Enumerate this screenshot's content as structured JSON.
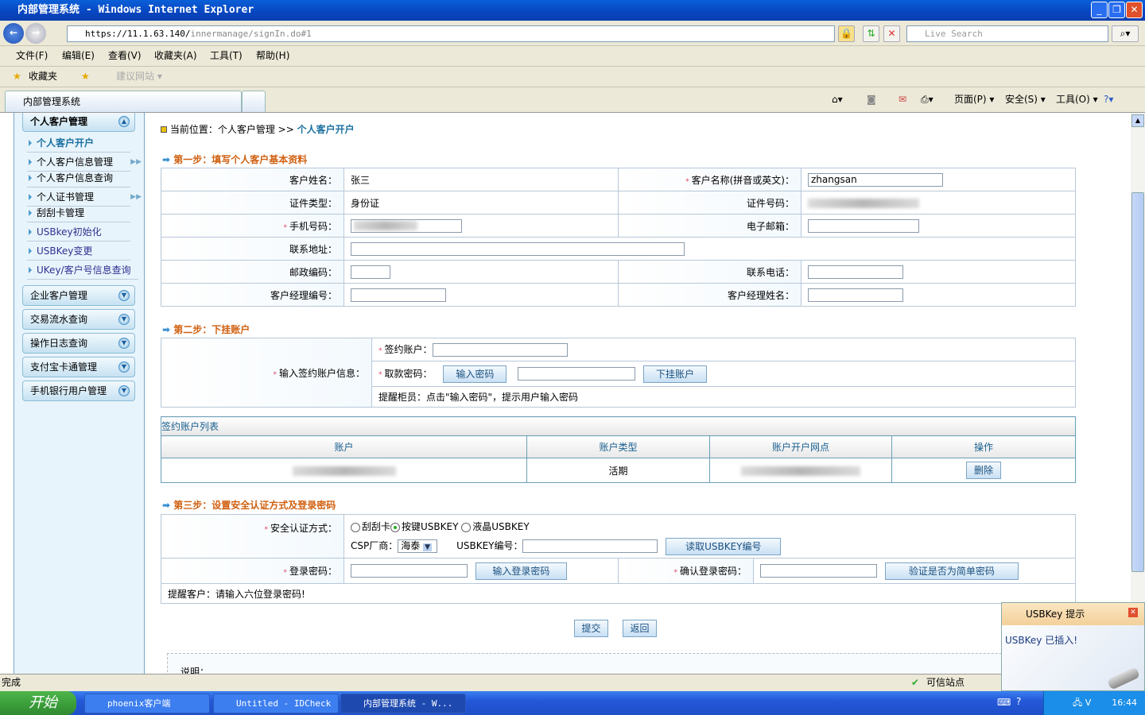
{
  "window": {
    "title": "内部管理系统 - Windows Internet Explorer",
    "min": "_",
    "max": "❐",
    "close": "✕"
  },
  "browser": {
    "url_host": "https://11.1.63.140/",
    "url_path": "innermanage/signIn.do#1",
    "search_placeholder": "Live Search",
    "menu": [
      "文件(F)",
      "编辑(E)",
      "查看(V)",
      "收藏夹(A)",
      "工具(T)",
      "帮助(H)"
    ],
    "favorites_label": "收藏夹",
    "suggested_sites": "建议网站 ▾",
    "tab_title": "内部管理系统",
    "commands": [
      "页面(P) ▾",
      "安全(S) ▾",
      "工具(O) ▾"
    ],
    "status": "完成",
    "zone": "可信站点"
  },
  "sidebar": {
    "groups": [
      "个人客户管理",
      "企业客户管理",
      "交易流水查询",
      "操作日志查询",
      "支付宝卡通管理",
      "手机银行用户管理"
    ],
    "items": [
      "个人客户开户",
      "个人客户信息管理",
      "个人客户信息查询",
      "个人证书管理",
      "刮刮卡管理",
      "USBkey初始化",
      "USBKey变更",
      "UKey/客户号信息查询"
    ]
  },
  "breadcrumb": {
    "prefix": "当前位置：个人客户管理 >> ",
    "current": "个人客户开户"
  },
  "step1": {
    "title": "第一步：填写个人客户基本资料",
    "labels": {
      "name": "客户姓名：",
      "name_en": "客户名称(拼音或英文)：",
      "id_type": "证件类型：",
      "id_no": "证件号码：",
      "mobile": "手机号码：",
      "email": "电子邮箱：",
      "address": "联系地址：",
      "zip": "邮政编码：",
      "phone": "联系电话：",
      "mgr_no": "客户经理编号：",
      "mgr_name": "客户经理姓名："
    },
    "values": {
      "name": "张三",
      "name_en": "zhangsan",
      "id_type": "身份证"
    }
  },
  "step2": {
    "title": "第二步：下挂账户",
    "label": "输入签约账户信息：",
    "account_label": "签约账户：",
    "pwd_label": "取款密码：",
    "enter_pwd": "输入密码",
    "attach": "下挂账户",
    "hint": "提醒柜员：点击\"输入密码\"，提示用户输入密码"
  },
  "accounts": {
    "title": "签约账户列表",
    "headers": [
      "账户",
      "账户类型",
      "账户开户网点",
      "操作"
    ],
    "rows": [
      {
        "type": "活期",
        "action": "删除"
      }
    ]
  },
  "step3": {
    "title": "第三步：设置安全认证方式及登录密码",
    "auth_label": "安全认证方式：",
    "options": [
      "刮刮卡",
      "按键USBKEY",
      "液晶USBKEY"
    ],
    "selected": 1,
    "csp_label": "CSP厂商：",
    "csp_value": "海泰",
    "usbkey_label": "USBKEY编号：",
    "read_btn": "读取USBKEY编号",
    "login_pwd": "登录密码：",
    "enter_login_pwd": "输入登录密码",
    "confirm_pwd": "确认登录密码：",
    "check_simple": "验证是否为简单密码",
    "hint": "提醒客户：请输入六位登录密码!"
  },
  "actions": {
    "submit": "提交",
    "back": "返回"
  },
  "notes_label": "说明：",
  "popup": {
    "title": "USBKey 提示",
    "message": "USBKey 已插入!"
  },
  "taskbar": {
    "start": "开始",
    "tasks": [
      "phoenix客户端",
      "Untitled - IDCheck",
      "内部管理系统 - W..."
    ],
    "clock": "16:44"
  }
}
